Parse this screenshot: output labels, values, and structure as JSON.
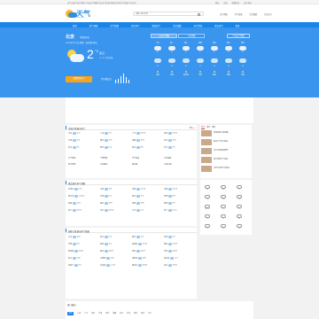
{
  "topbar": {
    "notice": "天气后报 中央气象台 专业天气预报 历史天气查询 全国天气网 空气质量 今日天气",
    "links": [
      "登录",
      "注册",
      "收藏本站",
      "设为首页"
    ]
  },
  "header": {
    "logo_text": "天气",
    "logo_sub": "tianqi.com",
    "search_placeholder": "请输入城市名称",
    "links": [
      "天气预报",
      "空气质量",
      "生活指数",
      "历史天气"
    ]
  },
  "nav": {
    "items": [
      "首页",
      "天气预报",
      "空气质量",
      "历史天气",
      "旅游天气",
      "生活指数",
      "天气资讯",
      "农业天气",
      "更多"
    ]
  },
  "current": {
    "city": "北京",
    "city_sub": "[切换城市]",
    "info": "2024年1月15日 星期一 农历腊月初五",
    "temp": "2",
    "unit": "°C",
    "condition": "多云",
    "condition_sub": "-5~4°C 北风2级",
    "button": "查看更多天气",
    "aqi": "空气质量 良",
    "aqi_levels": [
      0.35,
      0.5,
      0.75,
      1.0,
      0.6,
      0.4
    ]
  },
  "forecast": {
    "tabs": [
      "7天天气预报",
      "15天预报"
    ],
    "more": "40天天气预报",
    "days": [
      {
        "day": "今天",
        "hi": "4°",
        "lo": "-5°",
        "wind": "北风"
      },
      {
        "day": "周二",
        "hi": "5°",
        "lo": "-4°",
        "wind": "北风"
      },
      {
        "day": "周三",
        "hi": "3°",
        "lo": "-6°",
        "wind": "西北风"
      },
      {
        "day": "周四",
        "hi": "2°",
        "lo": "-7°",
        "wind": "北风"
      },
      {
        "day": "周五",
        "hi": "4°",
        "lo": "-5°",
        "wind": "南风"
      },
      {
        "day": "周六",
        "hi": "6°",
        "lo": "-3°",
        "wind": "南风"
      },
      {
        "day": "周日",
        "hi": "5°",
        "lo": "-4°",
        "wind": "北风"
      }
    ]
  },
  "section1": {
    "title": "全国主要城市天气",
    "more": "更多>>",
    "rows": [
      [
        {
          "c": "北京",
          "t": "4/-5"
        },
        {
          "c": "上海",
          "t": "9/3"
        },
        {
          "c": "广州",
          "t": "20/13"
        },
        {
          "c": "深圳",
          "t": "21/14"
        }
      ],
      [
        {
          "c": "天津",
          "t": "3/-6"
        },
        {
          "c": "重庆",
          "t": "11/7"
        },
        {
          "c": "成都",
          "t": "10/4"
        },
        {
          "c": "杭州",
          "t": "10/2"
        }
      ],
      [
        {
          "c": "武汉",
          "t": "8/1"
        },
        {
          "c": "西安",
          "t": "6/-3"
        },
        {
          "c": "南京",
          "t": "8/0"
        },
        {
          "c": "长沙",
          "t": "9/3"
        }
      ]
    ],
    "links": [
      "天气预报",
      "气象预警",
      "空气质量",
      "生活指数",
      "降水预报",
      "台风路径",
      "雷达图",
      "卫星云图"
    ]
  },
  "section2": {
    "title": "省会城市天气预报",
    "rows": [
      [
        {
          "c": "石家庄",
          "t": "5/-4"
        },
        {
          "c": "太原",
          "t": "3/-8"
        },
        {
          "c": "沈阳",
          "t": "-3/-14"
        },
        {
          "c": "长春",
          "t": "-8/-19"
        }
      ],
      [
        {
          "c": "哈尔滨",
          "t": "-10/-22"
        },
        {
          "c": "济南",
          "t": "6/-2"
        },
        {
          "c": "郑州",
          "t": "7/-2"
        },
        {
          "c": "合肥",
          "t": "8/0"
        }
      ],
      [
        {
          "c": "南昌",
          "t": "10/3"
        },
        {
          "c": "福州",
          "t": "16/9"
        },
        {
          "c": "昆明",
          "t": "18/5"
        },
        {
          "c": "贵阳",
          "t": "9/3"
        }
      ],
      [
        {
          "c": "南宁",
          "t": "19/12"
        },
        {
          "c": "海口",
          "t": "24/18"
        },
        {
          "c": "兰州",
          "t": "2/-9"
        },
        {
          "c": "西宁",
          "t": "0/-13"
        }
      ]
    ]
  },
  "section3": {
    "title": "国际主要城市天气预报",
    "rows": [
      [
        {
          "c": "东京",
          "t": "10/2"
        },
        {
          "c": "首尔",
          "t": "2/-6"
        },
        {
          "c": "纽约",
          "t": "3/-3"
        },
        {
          "c": "伦敦",
          "t": "7/2"
        }
      ],
      [
        {
          "c": "巴黎",
          "t": "8/3"
        },
        {
          "c": "柏林",
          "t": "3/-1"
        },
        {
          "c": "莫斯科",
          "t": "-6/-12"
        },
        {
          "c": "悉尼",
          "t": "27/19"
        }
      ],
      [
        {
          "c": "新加坡",
          "t": "31/25"
        },
        {
          "c": "曼谷",
          "t": "33/24"
        },
        {
          "c": "迪拜",
          "t": "24/17"
        },
        {
          "c": "开罗",
          "t": "20/10"
        }
      ],
      [
        {
          "c": "罗马",
          "t": "13/5"
        },
        {
          "c": "马德里",
          "t": "12/2"
        },
        {
          "c": "洛杉矶",
          "t": "20/9"
        },
        {
          "c": "多伦多",
          "t": "-1/-7"
        }
      ],
      [
        {
          "c": "温哥华",
          "t": "6/1"
        },
        {
          "c": "芝加哥",
          "t": "-4/-10"
        },
        {
          "c": "雅加达",
          "t": "30/24"
        },
        {
          "c": "孟买",
          "t": "31/20"
        }
      ]
    ]
  },
  "side": {
    "tabs": [
      "热点",
      "资讯",
      "图片"
    ],
    "items": [
      "寒潮来袭 注意保暖",
      "春运天气出行指南",
      "北方多地迎来降雪",
      "南方阴雨天气持续",
      "冷空气影响华北地区"
    ]
  },
  "side2": {
    "items": [
      "晴",
      "多云",
      "阴",
      "小雨",
      "中雨",
      "大雨",
      "雷阵雨",
      "小雪",
      "中雪",
      "大雪",
      "雾",
      "霾",
      "沙尘",
      "冰雹",
      "大风"
    ]
  },
  "footer": {
    "title": "热门城市",
    "links": [
      "北京",
      "上海",
      "广州",
      "深圳",
      "天津",
      "重庆",
      "成都",
      "杭州",
      "武汉",
      "西安",
      "南京",
      "长沙"
    ]
  }
}
